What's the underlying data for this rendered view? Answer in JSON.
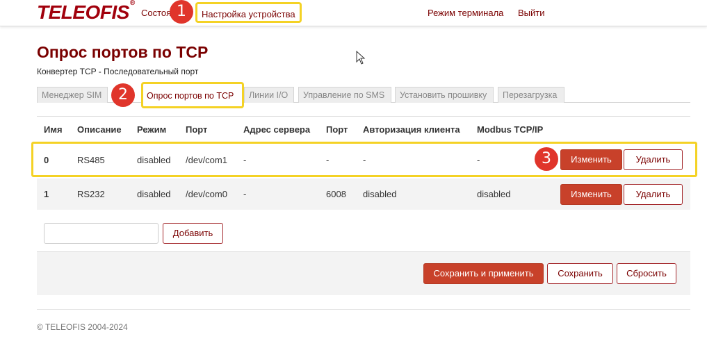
{
  "header": {
    "logo": "TELEOFIS",
    "logo_mark": "®",
    "nav": {
      "status": "Состояние",
      "settings": "Настройка устройства",
      "terminal": "Режим терминала",
      "logout": "Выйти"
    }
  },
  "badges": [
    "1",
    "2",
    "3"
  ],
  "page": {
    "title": "Опрос портов по TCP",
    "subtitle": "Конвертер TCP - Последовательный порт"
  },
  "tabs": [
    {
      "label": "Менеджер SIM"
    },
    {
      "label": "Опрос портов по TCP",
      "active": true
    },
    {
      "label": "Линии I/O"
    },
    {
      "label": "Управление по SMS"
    },
    {
      "label": "Установить прошивку"
    },
    {
      "label": "Перезагрузка"
    }
  ],
  "table": {
    "headers": [
      "Имя",
      "Описание",
      "Режим",
      "Порт",
      "Адрес сервера",
      "Порт",
      "Авторизация клиента",
      "Modbus TCP/IP"
    ],
    "rows": [
      {
        "name": "0",
        "description": "RS485",
        "mode": "disabled",
        "port": "/dev/com1",
        "server": "-",
        "server_port": "-",
        "auth": "-",
        "modbus": "-"
      },
      {
        "name": "1",
        "description": "RS232",
        "mode": "disabled",
        "port": "/dev/com0",
        "server": "-",
        "server_port": "6008",
        "auth": "disabled",
        "modbus": "disabled"
      }
    ],
    "edit_label": "Изменить",
    "delete_label": "Удалить"
  },
  "add": {
    "value": "",
    "button": "Добавить"
  },
  "actions": {
    "save_apply": "Сохранить и применить",
    "save": "Сохранить",
    "reset": "Сбросить"
  },
  "footer": "© TELEOFIS 2004-2024",
  "colors": {
    "brand": "#a1000c",
    "link": "#7a0000",
    "primary_button": "#c8412a",
    "highlight": "#f4d225",
    "badge": "#e0352b"
  }
}
